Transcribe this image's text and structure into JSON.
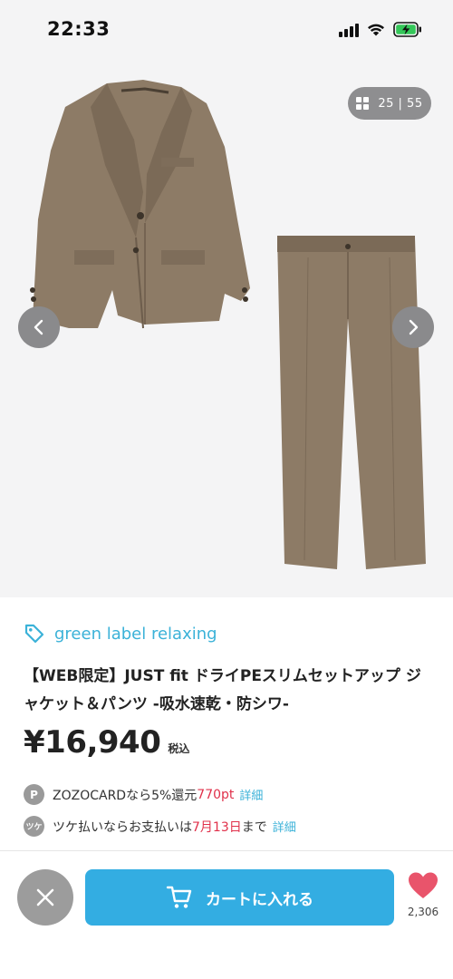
{
  "status_bar": {
    "time": "22:33"
  },
  "gallery": {
    "counter_text": "25 | 55"
  },
  "product": {
    "brand": "green label relaxing",
    "title": "【WEB限定】JUST fit ドライPEスリムセットアップ ジャケット＆パンツ -吸水速乾・防シワ-",
    "price": "¥16,940",
    "tax_label": "税込"
  },
  "promos": [
    {
      "badge": "P",
      "text_before": "ZOZOCARDなら5%還元 ",
      "highlight": "770pt",
      "text_after": "",
      "link": "詳細"
    },
    {
      "badge": "ツケ",
      "text_before": "ツケ払いならお支払いは",
      "highlight": "7月13日",
      "text_after": "まで",
      "link": "詳細"
    }
  ],
  "bottom_bar": {
    "cart_label": "カートに入れる",
    "favorite_count": "2,306"
  },
  "colors": {
    "accent": "#33ade2",
    "brand_link": "#3bb2d8",
    "highlight_red": "#e0304a",
    "heart": "#e9546b",
    "garment": "#8d7b66"
  },
  "icons": [
    "signal-icon",
    "wifi-icon",
    "battery-charging-icon",
    "grid-icon",
    "chevron-left-icon",
    "chevron-right-icon",
    "tag-icon",
    "close-icon",
    "cart-icon",
    "heart-icon"
  ]
}
